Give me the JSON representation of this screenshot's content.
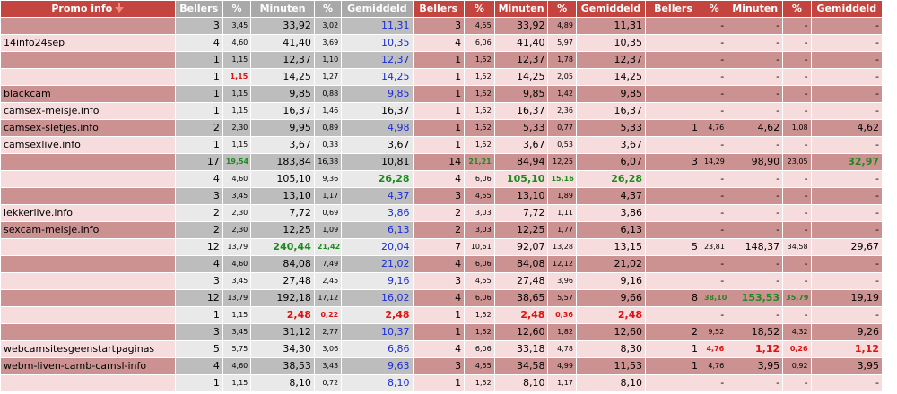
{
  "headers": {
    "promo": "Promo info",
    "sort_icon": "sort-descending-icon",
    "g1": [
      "Bellers",
      "%",
      "Minuten",
      "%",
      "Gemiddeld"
    ],
    "g2": [
      "Bellers",
      "%",
      "Minuten",
      "%",
      "Gemiddeld"
    ],
    "g3": [
      "Bellers",
      "%",
      "Minuten",
      "%",
      "Gemiddeld"
    ]
  },
  "colors": {
    "header_red": "#c4453f",
    "header_gray": "#a9a9a9",
    "row_dark": "#cc9292",
    "row_light": "#f6dcdc",
    "blue": "#1a2cd6",
    "green": "#1c8a1c",
    "red": "#e01010"
  },
  "rows": [
    {
      "name": "",
      "g1": [
        "3",
        "3,45",
        "33,92",
        "3,02",
        "11,31"
      ],
      "g2": [
        "3",
        "4,55",
        "33,92",
        "4,89",
        "11,31"
      ],
      "g3": [
        "",
        "-",
        "-",
        "-",
        "-"
      ]
    },
    {
      "name": "14info24sep",
      "g1": [
        "4",
        "4,60",
        "41,40",
        "3,69",
        "10,35"
      ],
      "g2": [
        "4",
        "6,06",
        "41,40",
        "5,97",
        "10,35"
      ],
      "g3": [
        "",
        "-",
        "-",
        "-",
        "-"
      ]
    },
    {
      "name": "",
      "g1": [
        "1",
        "1,15",
        "12,37",
        "1,10",
        "12,37"
      ],
      "g2": [
        "1",
        "1,52",
        "12,37",
        "1,78",
        "12,37"
      ],
      "g3": [
        "",
        "-",
        "-",
        "-",
        "-"
      ]
    },
    {
      "name": "",
      "g1": [
        "1",
        "1,15",
        "14,25",
        "1,27",
        "14,25"
      ],
      "g2": [
        "1",
        "1,52",
        "14,25",
        "2,05",
        "14,25"
      ],
      "g3": [
        "",
        "-",
        "-",
        "-",
        "-"
      ]
    },
    {
      "name": "blackcam",
      "g1": [
        "1",
        "1,15",
        "9,85",
        "0,88",
        "9,85"
      ],
      "g2": [
        "1",
        "1,52",
        "9,85",
        "1,42",
        "9,85"
      ],
      "g3": [
        "",
        "-",
        "-",
        "-",
        "-"
      ]
    },
    {
      "name": "camsex-meisje.info",
      "g1": [
        "1",
        "1,15",
        "16,37",
        "1,46",
        "16,37"
      ],
      "g2": [
        "1",
        "1,52",
        "16,37",
        "2,36",
        "16,37"
      ],
      "g3": [
        "",
        "-",
        "-",
        "-",
        "-"
      ]
    },
    {
      "name": "camsex-sletjes.info",
      "g1": [
        "2",
        "2,30",
        "9,95",
        "0,89",
        "4,98"
      ],
      "g2": [
        "1",
        "1,52",
        "5,33",
        "0,77",
        "5,33"
      ],
      "g3": [
        "1",
        "4,76",
        "4,62",
        "1,08",
        "4,62"
      ]
    },
    {
      "name": "camsexlive.info",
      "g1": [
        "1",
        "1,15",
        "3,67",
        "0,33",
        "3,67"
      ],
      "g2": [
        "1",
        "1,52",
        "3,67",
        "0,53",
        "3,67"
      ],
      "g3": [
        "",
        "-",
        "-",
        "-",
        "-"
      ]
    },
    {
      "name": "",
      "g1": [
        "17",
        "19,54",
        "183,84",
        "16,38",
        "10,81"
      ],
      "g2": [
        "14",
        "21,21",
        "84,94",
        "12,25",
        "6,07"
      ],
      "g3": [
        "3",
        "14,29",
        "98,90",
        "23,05",
        "32,97"
      ]
    },
    {
      "name": "",
      "g1": [
        "4",
        "4,60",
        "105,10",
        "9,36",
        "26,28"
      ],
      "g2": [
        "4",
        "6,06",
        "105,10",
        "15,16",
        "26,28"
      ],
      "g3": [
        "",
        "-",
        "-",
        "-",
        "-"
      ]
    },
    {
      "name": "",
      "g1": [
        "3",
        "3,45",
        "13,10",
        "1,17",
        "4,37"
      ],
      "g2": [
        "3",
        "4,55",
        "13,10",
        "1,89",
        "4,37"
      ],
      "g3": [
        "",
        "-",
        "-",
        "-",
        "-"
      ]
    },
    {
      "name": "lekkerlive.info",
      "g1": [
        "2",
        "2,30",
        "7,72",
        "0,69",
        "3,86"
      ],
      "g2": [
        "2",
        "3,03",
        "7,72",
        "1,11",
        "3,86"
      ],
      "g3": [
        "",
        "-",
        "-",
        "-",
        "-"
      ]
    },
    {
      "name": "sexcam-meisje.info",
      "g1": [
        "2",
        "2,30",
        "12,25",
        "1,09",
        "6,13"
      ],
      "g2": [
        "2",
        "3,03",
        "12,25",
        "1,77",
        "6,13"
      ],
      "g3": [
        "",
        "-",
        "-",
        "-",
        "-"
      ]
    },
    {
      "name": "",
      "g1": [
        "12",
        "13,79",
        "240,44",
        "21,42",
        "20,04"
      ],
      "g2": [
        "7",
        "10,61",
        "92,07",
        "13,28",
        "13,15"
      ],
      "g3": [
        "5",
        "23,81",
        "148,37",
        "34,58",
        "29,67"
      ]
    },
    {
      "name": "",
      "g1": [
        "4",
        "4,60",
        "84,08",
        "7,49",
        "21,02"
      ],
      "g2": [
        "4",
        "6,06",
        "84,08",
        "12,12",
        "21,02"
      ],
      "g3": [
        "",
        "-",
        "-",
        "-",
        "-"
      ]
    },
    {
      "name": "",
      "g1": [
        "3",
        "3,45",
        "27,48",
        "2,45",
        "9,16"
      ],
      "g2": [
        "3",
        "4,55",
        "27,48",
        "3,96",
        "9,16"
      ],
      "g3": [
        "",
        "-",
        "-",
        "-",
        "-"
      ]
    },
    {
      "name": "",
      "g1": [
        "12",
        "13,79",
        "192,18",
        "17,12",
        "16,02"
      ],
      "g2": [
        "4",
        "6,06",
        "38,65",
        "5,57",
        "9,66"
      ],
      "g3": [
        "8",
        "38,10",
        "153,53",
        "35,79",
        "19,19"
      ]
    },
    {
      "name": "",
      "g1": [
        "1",
        "1,15",
        "2,48",
        "0,22",
        "2,48"
      ],
      "g2": [
        "1",
        "1,52",
        "2,48",
        "0,36",
        "2,48"
      ],
      "g3": [
        "",
        "-",
        "-",
        "-",
        "-"
      ]
    },
    {
      "name": "",
      "g1": [
        "3",
        "3,45",
        "31,12",
        "2,77",
        "10,37"
      ],
      "g2": [
        "1",
        "1,52",
        "12,60",
        "1,82",
        "12,60"
      ],
      "g3": [
        "2",
        "9,52",
        "18,52",
        "4,32",
        "9,26"
      ]
    },
    {
      "name": "webcamsitesgeenstartpaginas",
      "g1": [
        "5",
        "5,75",
        "34,30",
        "3,06",
        "6,86"
      ],
      "g2": [
        "4",
        "6,06",
        "33,18",
        "4,78",
        "8,30"
      ],
      "g3": [
        "1",
        "4,76",
        "1,12",
        "0,26",
        "1,12"
      ]
    },
    {
      "name": "webm-liven-camb-camsl-info",
      "g1": [
        "4",
        "4,60",
        "38,53",
        "3,43",
        "9,63"
      ],
      "g2": [
        "3",
        "4,55",
        "34,58",
        "4,99",
        "11,53"
      ],
      "g3": [
        "1",
        "4,76",
        "3,95",
        "0,92",
        "3,95"
      ]
    },
    {
      "name": "",
      "g1": [
        "1",
        "1,15",
        "8,10",
        "0,72",
        "8,10"
      ],
      "g2": [
        "1",
        "1,52",
        "8,10",
        "1,17",
        "8,10"
      ],
      "g3": [
        "",
        "-",
        "-",
        "-",
        "-"
      ]
    }
  ]
}
